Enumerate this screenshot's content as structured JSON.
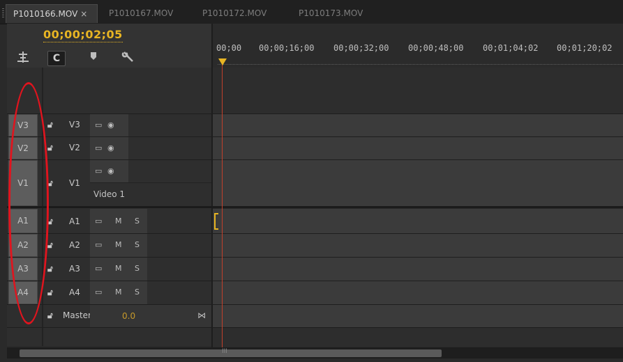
{
  "tabs": [
    {
      "label": "P1010166.MOV",
      "close": "×",
      "active": true
    },
    {
      "label": "P1010167.MOV",
      "active": false
    },
    {
      "label": "P1010172.MOV",
      "active": false
    },
    {
      "label": "P1010173.MOV",
      "active": false
    }
  ],
  "timecode": "00;00;02;05",
  "tools": {
    "snap_icon": "C",
    "marker_icon": "marker-icon",
    "wrench_icon": "wrench-icon",
    "sequence_icon": "nest-icon"
  },
  "ruler": {
    "ticks": [
      "00;00",
      "00;00;16;00",
      "00;00;32;00",
      "00;00;48;00",
      "00;01;04;02",
      "00;01;20;02"
    ]
  },
  "video_tracks": [
    {
      "target": "V3",
      "name": "V3"
    },
    {
      "target": "V2",
      "name": "V2"
    },
    {
      "target": "V1",
      "name": "V1",
      "label": "Video 1"
    }
  ],
  "audio_tracks": [
    {
      "target": "A1",
      "name": "A1",
      "mute": "M",
      "solo": "S"
    },
    {
      "target": "A2",
      "name": "A2",
      "mute": "M",
      "solo": "S"
    },
    {
      "target": "A3",
      "name": "A3",
      "mute": "M",
      "solo": "S"
    },
    {
      "target": "A4",
      "name": "A4",
      "mute": "M",
      "solo": "S"
    }
  ],
  "master": {
    "label": "Master",
    "value": "0.0"
  },
  "scroll_grip": "III",
  "colors": {
    "timecode": "#e8b523",
    "playhead": "#c2412b",
    "annotation": "#e0141e"
  }
}
